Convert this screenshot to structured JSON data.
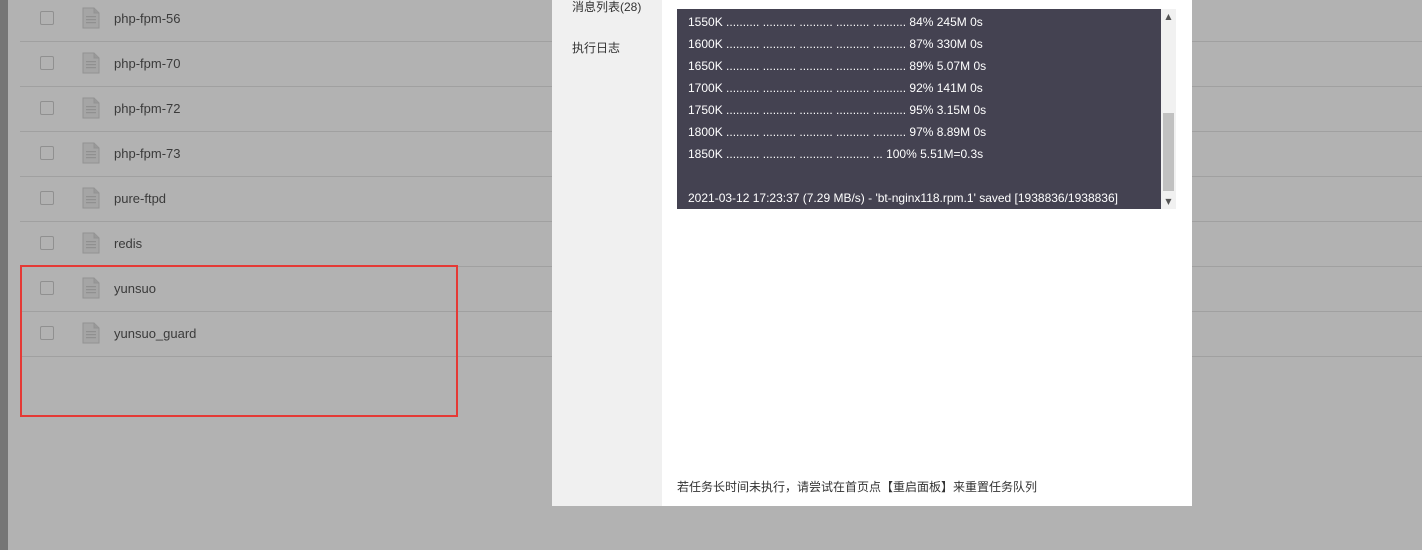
{
  "files": [
    {
      "name": "php-fpm-56"
    },
    {
      "name": "php-fpm-70"
    },
    {
      "name": "php-fpm-72"
    },
    {
      "name": "php-fpm-73"
    },
    {
      "name": "pure-ftpd"
    },
    {
      "name": "redis"
    },
    {
      "name": "yunsuo"
    },
    {
      "name": "yunsuo_guard"
    }
  ],
  "modal": {
    "sidebar": {
      "message_list": "消息列表(28)",
      "exec_log": "执行日志"
    },
    "terminal_lines": [
      "1550K .......... .......... .......... .......... .......... 84% 245M 0s",
      "1600K .......... .......... .......... .......... .......... 87% 330M 0s",
      "1650K .......... .......... .......... .......... .......... 89% 5.07M 0s",
      "1700K .......... .......... .......... .......... .......... 92% 141M 0s",
      "1750K .......... .......... .......... .......... .......... 95% 3.15M 0s",
      "1800K .......... .......... .......... .......... .......... 97% 8.89M 0s",
      "1850K .......... .......... .......... .......... ... 100% 5.51M=0.3s",
      "",
      "2021-03-12 17:23:37 (7.29 MB/s) - 'bt-nginx118.rpm.1' saved [1938836/1938836]"
    ],
    "footer_note": "若任务长时间未执行，请尝试在首页点【重启面板】来重置任务队列"
  },
  "colors": {
    "terminal_bg": "#444251",
    "highlight_border": "#e53935",
    "overlay": "rgba(0,0,0,0.30)"
  },
  "icons": {
    "file": "file-icon",
    "scroll_up": "triangle-up-icon",
    "scroll_down": "triangle-down-icon"
  }
}
